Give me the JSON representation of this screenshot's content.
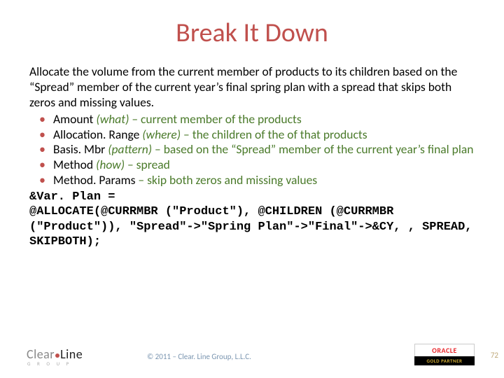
{
  "title": "Break It Down",
  "intro": "Allocate the volume from the current member of products to its children based on the “Spread” member of the current year’s final spring plan with a spread that skips both zeros and missing values.",
  "bullets": [
    {
      "label": "Amount ",
      "paren": "(what)",
      "rest": " – current member of the products"
    },
    {
      "label": "Allocation. Range ",
      "paren": "(where)",
      "rest": " – the children of the of that products"
    },
    {
      "label": "Basis. Mbr ",
      "paren": "(pattern)",
      "rest": " – based on the “Spread” member of the current year’s final plan"
    },
    {
      "label": "Method ",
      "paren": "(how)",
      "rest": " – spread"
    },
    {
      "label": "Method. Params ",
      "paren": "",
      "rest": "– skip both zeros and missing values"
    }
  ],
  "code": {
    "l1": "&Var. Plan =",
    "l2": "@ALLOCATE(@CURRMBR (\"Product\"), @CHILDREN (@CURRMBR (\"Product\")), \"Spread\"->\"Spring Plan\"->\"Final\"->&CY, , SPREAD, SKIPBOTH);"
  },
  "footer": {
    "logo_clear": "Clear",
    "logo_line": "Line",
    "logo_sub": "G R O U P",
    "copyright": "© 2011 – Clear. Line Group, L.L.C.",
    "oracle_top": "ORACLE",
    "oracle_bot": "GOLD PARTNER",
    "pagenum": "72"
  }
}
